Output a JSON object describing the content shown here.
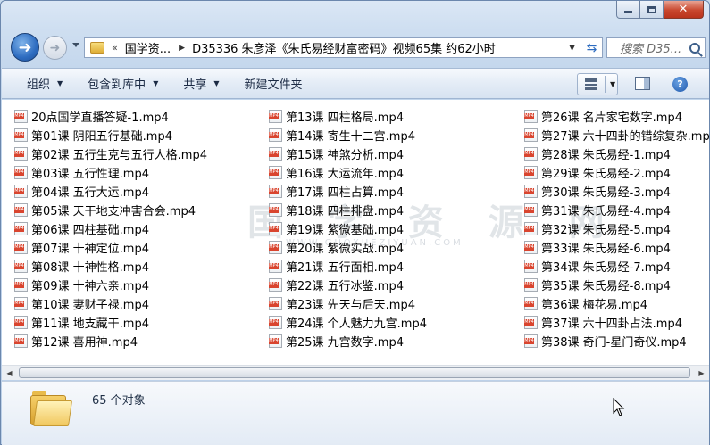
{
  "window": {
    "address": {
      "chevron": "«",
      "segments": [
        "国学资...",
        "D35336 朱彦泽《朱氏易经财富密码》视频65集 约62小时"
      ]
    },
    "search_placeholder": "搜索 D35..."
  },
  "toolbar": {
    "organize": "组织",
    "include_in_library": "包含到库中",
    "share": "共享",
    "new_folder": "新建文件夹"
  },
  "files": {
    "column1": [
      "20点国学直播答疑-1.mp4",
      "第01课 阴阳五行基础.mp4",
      "第02课 五行生克与五行人格.mp4",
      "第03课 五行性理.mp4",
      "第04课 五行大运.mp4",
      "第05课 天干地支冲害合会.mp4",
      "第06课 四柱基础.mp4",
      "第07课 十神定位.mp4",
      "第08课 十神性格.mp4",
      "第09课 十神六亲.mp4",
      "第10课 妻财子禄.mp4",
      "第11课 地支藏干.mp4",
      "第12课 喜用神.mp4"
    ],
    "column2": [
      "第13课 四柱格局.mp4",
      "第14课 寄生十二宫.mp4",
      "第15课 神煞分析.mp4",
      "第16课 大运流年.mp4",
      "第17课 四柱占算.mp4",
      "第18课 四柱排盘.mp4",
      "第19课 紫微基础.mp4",
      "第20课 紫微实战.mp4",
      "第21课 五行面相.mp4",
      "第22课 五行冰鉴.mp4",
      "第23课 先天与后天.mp4",
      "第24课 个人魅力九宫.mp4",
      "第25课 九宫数字.mp4"
    ],
    "column3": [
      "第26课 名片家宅数字.mp4",
      "第27课 六十四卦的错综复杂.mp4",
      "第28课 朱氏易经-1.mp4",
      "第29课 朱氏易经-2.mp4",
      "第30课 朱氏易经-3.mp4",
      "第31课 朱氏易经-4.mp4",
      "第32课 朱氏易经-5.mp4",
      "第33课 朱氏易经-6.mp4",
      "第34课 朱氏易经-7.mp4",
      "第35课 朱氏易经-8.mp4",
      "第36课 梅花易.mp4",
      "第37课 六十四卦占法.mp4",
      "第38课 奇门-星门奇仪.mp4"
    ]
  },
  "watermark": {
    "main": "国 学 资 源 网",
    "sub": "WWW.GUOXUEZIYUAN.COM"
  },
  "details": {
    "count": "65 个对象"
  },
  "icons": {
    "back": "arrow-left-icon",
    "forward": "arrow-right-icon",
    "refresh": "refresh-icon",
    "search": "search-icon",
    "file": "mp4-file-icon",
    "folder": "folder-icon",
    "help": "help-icon"
  }
}
